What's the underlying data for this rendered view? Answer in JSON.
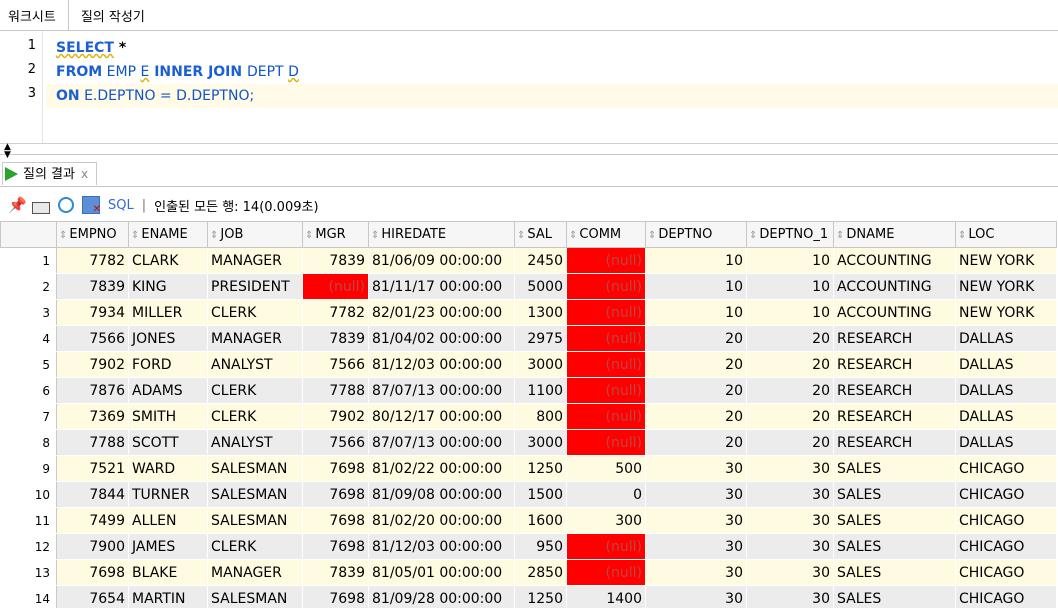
{
  "tabs": [
    "워크시트",
    "질의 작성기"
  ],
  "editor": {
    "lines": [
      {
        "n": "1",
        "kw1": "SELECT",
        "rest": " *"
      },
      {
        "n": "2",
        "kw1": "FROM",
        "rest1": " EMP ",
        "alias1": "E",
        "kw2": " INNER JOIN ",
        "rest2": "DEPT ",
        "alias2": "D"
      },
      {
        "n": "3",
        "kw1": "ON",
        "rest": " E.DEPTNO = D.DEPTNO;"
      }
    ]
  },
  "results": {
    "tab_label": "질의 결과",
    "close": "x",
    "sql_label": "SQL",
    "separator": "|",
    "fetch_status": "인출된 모든 행: 14(0.009초)",
    "null_text": "(null)",
    "columns": [
      "EMPNO",
      "ENAME",
      "JOB",
      "MGR",
      "HIREDATE",
      "SAL",
      "COMM",
      "DEPTNO",
      "DEPTNO_1",
      "DNAME",
      "LOC"
    ],
    "rows": [
      [
        "1",
        "7782",
        "CLARK",
        "MANAGER",
        "7839",
        "81/06/09 00:00:00",
        "2450",
        "(null)",
        "10",
        "10",
        "ACCOUNTING",
        "NEW YORK"
      ],
      [
        "2",
        "7839",
        "KING",
        "PRESIDENT",
        "(null)",
        "81/11/17 00:00:00",
        "5000",
        "(null)",
        "10",
        "10",
        "ACCOUNTING",
        "NEW YORK"
      ],
      [
        "3",
        "7934",
        "MILLER",
        "CLERK",
        "7782",
        "82/01/23 00:00:00",
        "1300",
        "(null)",
        "10",
        "10",
        "ACCOUNTING",
        "NEW YORK"
      ],
      [
        "4",
        "7566",
        "JONES",
        "MANAGER",
        "7839",
        "81/04/02 00:00:00",
        "2975",
        "(null)",
        "20",
        "20",
        "RESEARCH",
        "DALLAS"
      ],
      [
        "5",
        "7902",
        "FORD",
        "ANALYST",
        "7566",
        "81/12/03 00:00:00",
        "3000",
        "(null)",
        "20",
        "20",
        "RESEARCH",
        "DALLAS"
      ],
      [
        "6",
        "7876",
        "ADAMS",
        "CLERK",
        "7788",
        "87/07/13 00:00:00",
        "1100",
        "(null)",
        "20",
        "20",
        "RESEARCH",
        "DALLAS"
      ],
      [
        "7",
        "7369",
        "SMITH",
        "CLERK",
        "7902",
        "80/12/17 00:00:00",
        "800",
        "(null)",
        "20",
        "20",
        "RESEARCH",
        "DALLAS"
      ],
      [
        "8",
        "7788",
        "SCOTT",
        "ANALYST",
        "7566",
        "87/07/13 00:00:00",
        "3000",
        "(null)",
        "20",
        "20",
        "RESEARCH",
        "DALLAS"
      ],
      [
        "9",
        "7521",
        "WARD",
        "SALESMAN",
        "7698",
        "81/02/22 00:00:00",
        "1250",
        "500",
        "30",
        "30",
        "SALES",
        "CHICAGO"
      ],
      [
        "10",
        "7844",
        "TURNER",
        "SALESMAN",
        "7698",
        "81/09/08 00:00:00",
        "1500",
        "0",
        "30",
        "30",
        "SALES",
        "CHICAGO"
      ],
      [
        "11",
        "7499",
        "ALLEN",
        "SALESMAN",
        "7698",
        "81/02/20 00:00:00",
        "1600",
        "300",
        "30",
        "30",
        "SALES",
        "CHICAGO"
      ],
      [
        "12",
        "7900",
        "JAMES",
        "CLERK",
        "7698",
        "81/12/03 00:00:00",
        "950",
        "(null)",
        "30",
        "30",
        "SALES",
        "CHICAGO"
      ],
      [
        "13",
        "7698",
        "BLAKE",
        "MANAGER",
        "7839",
        "81/05/01 00:00:00",
        "2850",
        "(null)",
        "30",
        "30",
        "SALES",
        "CHICAGO"
      ],
      [
        "14",
        "7654",
        "MARTIN",
        "SALESMAN",
        "7698",
        "81/09/28 00:00:00",
        "1250",
        "1400",
        "30",
        "30",
        "SALES",
        "CHICAGO"
      ]
    ]
  },
  "colors": {
    "null_cell": "#ff0000",
    "keyword": "#1b5fd6",
    "odd_row": "#fffbe0",
    "even_row": "#ececec"
  }
}
